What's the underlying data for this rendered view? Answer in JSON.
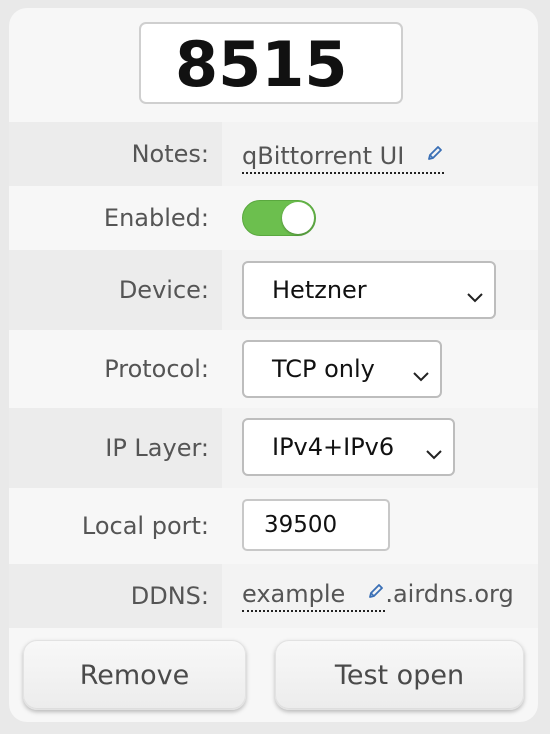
{
  "port": {
    "number": "8515"
  },
  "fields": {
    "notes": {
      "label": "Notes:",
      "value": "qBittorrent UI",
      "edit_icon": "pencil-icon"
    },
    "enabled": {
      "label": "Enabled:",
      "state": true,
      "color": "#6cbf4e"
    },
    "device": {
      "label": "Device:",
      "selected": "Hetzner"
    },
    "protocol": {
      "label": "Protocol:",
      "selected": "TCP only"
    },
    "ip_layer": {
      "label": "IP Layer:",
      "selected": "IPv4+IPv6"
    },
    "local_port": {
      "label": "Local port:",
      "value": "39500"
    },
    "ddns": {
      "label": "DDNS:",
      "value": "example",
      "suffix": ".airdns.org",
      "edit_icon": "pencil-icon"
    }
  },
  "actions": {
    "remove": "Remove",
    "test_open": "Test open"
  }
}
